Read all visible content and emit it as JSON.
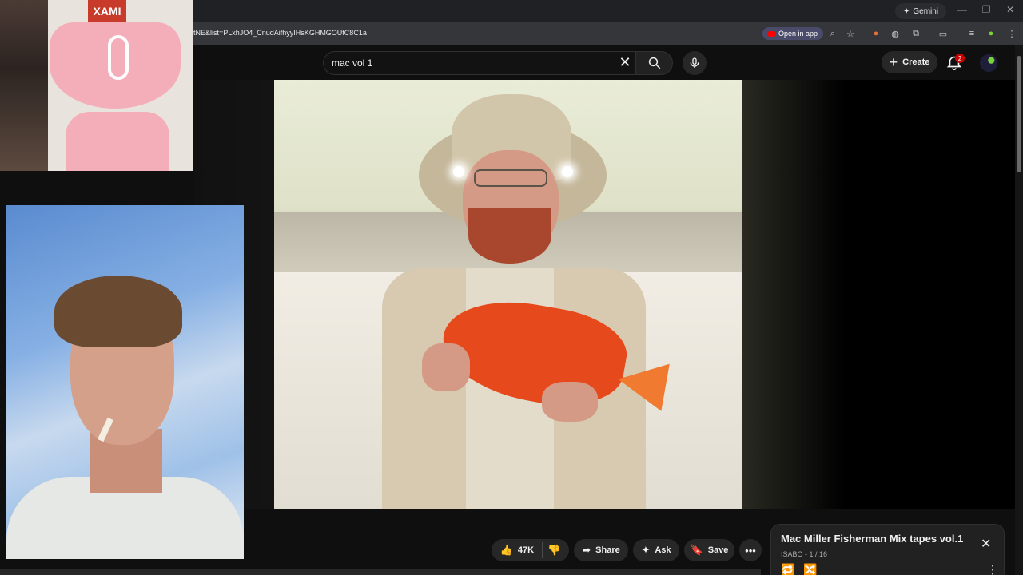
{
  "browser": {
    "gemini_label": "Gemini",
    "url": "tNE&list=PLxhJO4_CnudAifhyyIHsKGHMGOUtC8C1a",
    "open_in_app_label": "Open in app"
  },
  "header": {
    "search_value": "mac vol 1",
    "create_label": "Create",
    "notification_count": "2"
  },
  "webcam": {
    "poster_text": "XAMI"
  },
  "actions": {
    "like_count": "47K",
    "share_label": "Share",
    "ask_label": "Ask",
    "save_label": "Save"
  },
  "playlist": {
    "title": "Mac Miller Fisherman Mix tapes vol.1",
    "subtitle": "ISABO - 1 / 16"
  },
  "colors": {
    "background": "#0f0f0f",
    "pill": "#272727",
    "badge": "#cc0000",
    "brand_red": "#ff0000"
  }
}
